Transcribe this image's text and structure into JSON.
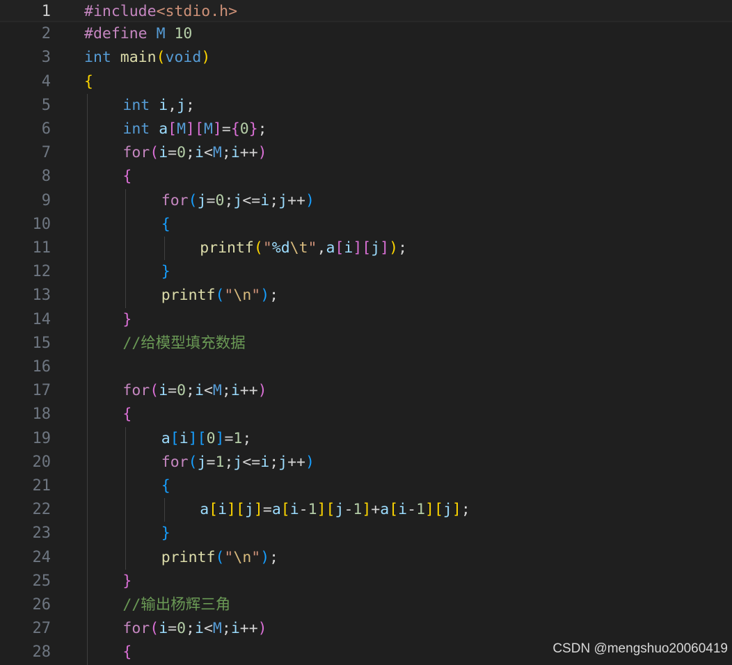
{
  "editor": {
    "active_line": 1,
    "colors": {
      "background": "#1f1f1f",
      "line_number": "#6e7681",
      "line_number_active": "#cccccc",
      "keyword": "#569cd6",
      "control": "#c586c0",
      "function": "#dcdcaa",
      "variable": "#9cdcfe",
      "number": "#b5cea8",
      "string": "#ce9178",
      "escape": "#d7ba7d",
      "comment": "#6a9955",
      "bracket_gold": "#ffd700",
      "bracket_pink": "#da70d6",
      "bracket_blue": "#179fff",
      "plain": "#d4d4d4"
    },
    "lines": [
      {
        "n": "1",
        "indent": 0,
        "tokens": [
          {
            "t": "#include",
            "c": "control"
          },
          {
            "t": "<stdio.h>",
            "c": "string"
          }
        ]
      },
      {
        "n": "2",
        "indent": 0,
        "tokens": [
          {
            "t": "#define",
            "c": "control"
          },
          {
            "t": " ",
            "c": "plain"
          },
          {
            "t": "M",
            "c": "keyword"
          },
          {
            "t": " ",
            "c": "plain"
          },
          {
            "t": "10",
            "c": "number"
          }
        ]
      },
      {
        "n": "3",
        "indent": 0,
        "tokens": [
          {
            "t": "int",
            "c": "keyword"
          },
          {
            "t": " ",
            "c": "plain"
          },
          {
            "t": "main",
            "c": "function"
          },
          {
            "t": "(",
            "c": "bracket_gold"
          },
          {
            "t": "void",
            "c": "keyword"
          },
          {
            "t": ")",
            "c": "bracket_gold"
          }
        ]
      },
      {
        "n": "4",
        "indent": 0,
        "tokens": [
          {
            "t": "{",
            "c": "bracket_gold"
          }
        ]
      },
      {
        "n": "5",
        "indent": 1,
        "tokens": [
          {
            "t": "int",
            "c": "keyword"
          },
          {
            "t": " ",
            "c": "plain"
          },
          {
            "t": "i",
            "c": "variable"
          },
          {
            "t": ",",
            "c": "plain"
          },
          {
            "t": "j",
            "c": "variable"
          },
          {
            "t": ";",
            "c": "plain"
          }
        ]
      },
      {
        "n": "6",
        "indent": 1,
        "tokens": [
          {
            "t": "int",
            "c": "keyword"
          },
          {
            "t": " ",
            "c": "plain"
          },
          {
            "t": "a",
            "c": "variable"
          },
          {
            "t": "[",
            "c": "bracket_pink"
          },
          {
            "t": "M",
            "c": "keyword"
          },
          {
            "t": "]",
            "c": "bracket_pink"
          },
          {
            "t": "[",
            "c": "bracket_pink"
          },
          {
            "t": "M",
            "c": "keyword"
          },
          {
            "t": "]",
            "c": "bracket_pink"
          },
          {
            "t": "=",
            "c": "plain"
          },
          {
            "t": "{",
            "c": "bracket_pink"
          },
          {
            "t": "0",
            "c": "number"
          },
          {
            "t": "}",
            "c": "bracket_pink"
          },
          {
            "t": ";",
            "c": "plain"
          }
        ]
      },
      {
        "n": "7",
        "indent": 1,
        "tokens": [
          {
            "t": "for",
            "c": "control"
          },
          {
            "t": "(",
            "c": "bracket_pink"
          },
          {
            "t": "i",
            "c": "variable"
          },
          {
            "t": "=",
            "c": "plain"
          },
          {
            "t": "0",
            "c": "number"
          },
          {
            "t": ";",
            "c": "plain"
          },
          {
            "t": "i",
            "c": "variable"
          },
          {
            "t": "<",
            "c": "plain"
          },
          {
            "t": "M",
            "c": "keyword"
          },
          {
            "t": ";",
            "c": "plain"
          },
          {
            "t": "i",
            "c": "variable"
          },
          {
            "t": "++",
            "c": "plain"
          },
          {
            "t": ")",
            "c": "bracket_pink"
          }
        ]
      },
      {
        "n": "8",
        "indent": 1,
        "tokens": [
          {
            "t": "{",
            "c": "bracket_pink"
          }
        ]
      },
      {
        "n": "9",
        "indent": 2,
        "tokens": [
          {
            "t": "for",
            "c": "control"
          },
          {
            "t": "(",
            "c": "bracket_blue"
          },
          {
            "t": "j",
            "c": "variable"
          },
          {
            "t": "=",
            "c": "plain"
          },
          {
            "t": "0",
            "c": "number"
          },
          {
            "t": ";",
            "c": "plain"
          },
          {
            "t": "j",
            "c": "variable"
          },
          {
            "t": "<=",
            "c": "plain"
          },
          {
            "t": "i",
            "c": "variable"
          },
          {
            "t": ";",
            "c": "plain"
          },
          {
            "t": "j",
            "c": "variable"
          },
          {
            "t": "++",
            "c": "plain"
          },
          {
            "t": ")",
            "c": "bracket_blue"
          }
        ]
      },
      {
        "n": "10",
        "indent": 2,
        "tokens": [
          {
            "t": "{",
            "c": "bracket_blue"
          }
        ]
      },
      {
        "n": "11",
        "indent": 3,
        "tokens": [
          {
            "t": "printf",
            "c": "function"
          },
          {
            "t": "(",
            "c": "bracket_gold"
          },
          {
            "t": "\"",
            "c": "string"
          },
          {
            "t": "%d",
            "c": "variable"
          },
          {
            "t": "\\t",
            "c": "escape"
          },
          {
            "t": "\"",
            "c": "string"
          },
          {
            "t": ",",
            "c": "plain"
          },
          {
            "t": "a",
            "c": "variable"
          },
          {
            "t": "[",
            "c": "bracket_pink"
          },
          {
            "t": "i",
            "c": "variable"
          },
          {
            "t": "]",
            "c": "bracket_pink"
          },
          {
            "t": "[",
            "c": "bracket_pink"
          },
          {
            "t": "j",
            "c": "variable"
          },
          {
            "t": "]",
            "c": "bracket_pink"
          },
          {
            "t": ")",
            "c": "bracket_gold"
          },
          {
            "t": ";",
            "c": "plain"
          }
        ]
      },
      {
        "n": "12",
        "indent": 2,
        "tokens": [
          {
            "t": "}",
            "c": "bracket_blue"
          }
        ]
      },
      {
        "n": "13",
        "indent": 2,
        "tokens": [
          {
            "t": "printf",
            "c": "function"
          },
          {
            "t": "(",
            "c": "bracket_blue"
          },
          {
            "t": "\"",
            "c": "string"
          },
          {
            "t": "\\n",
            "c": "escape"
          },
          {
            "t": "\"",
            "c": "string"
          },
          {
            "t": ")",
            "c": "bracket_blue"
          },
          {
            "t": ";",
            "c": "plain"
          }
        ]
      },
      {
        "n": "14",
        "indent": 1,
        "tokens": [
          {
            "t": "}",
            "c": "bracket_pink"
          }
        ]
      },
      {
        "n": "15",
        "indent": 1,
        "tokens": [
          {
            "t": "//给模型填充数据",
            "c": "comment"
          }
        ]
      },
      {
        "n": "16",
        "indent": 1,
        "tokens": []
      },
      {
        "n": "17",
        "indent": 1,
        "tokens": [
          {
            "t": "for",
            "c": "control"
          },
          {
            "t": "(",
            "c": "bracket_pink"
          },
          {
            "t": "i",
            "c": "variable"
          },
          {
            "t": "=",
            "c": "plain"
          },
          {
            "t": "0",
            "c": "number"
          },
          {
            "t": ";",
            "c": "plain"
          },
          {
            "t": "i",
            "c": "variable"
          },
          {
            "t": "<",
            "c": "plain"
          },
          {
            "t": "M",
            "c": "keyword"
          },
          {
            "t": ";",
            "c": "plain"
          },
          {
            "t": "i",
            "c": "variable"
          },
          {
            "t": "++",
            "c": "plain"
          },
          {
            "t": ")",
            "c": "bracket_pink"
          }
        ]
      },
      {
        "n": "18",
        "indent": 1,
        "tokens": [
          {
            "t": "{",
            "c": "bracket_pink"
          }
        ]
      },
      {
        "n": "19",
        "indent": 2,
        "tokens": [
          {
            "t": "a",
            "c": "variable"
          },
          {
            "t": "[",
            "c": "bracket_blue"
          },
          {
            "t": "i",
            "c": "variable"
          },
          {
            "t": "]",
            "c": "bracket_blue"
          },
          {
            "t": "[",
            "c": "bracket_blue"
          },
          {
            "t": "0",
            "c": "number"
          },
          {
            "t": "]",
            "c": "bracket_blue"
          },
          {
            "t": "=",
            "c": "plain"
          },
          {
            "t": "1",
            "c": "number"
          },
          {
            "t": ";",
            "c": "plain"
          }
        ]
      },
      {
        "n": "20",
        "indent": 2,
        "tokens": [
          {
            "t": "for",
            "c": "control"
          },
          {
            "t": "(",
            "c": "bracket_blue"
          },
          {
            "t": "j",
            "c": "variable"
          },
          {
            "t": "=",
            "c": "plain"
          },
          {
            "t": "1",
            "c": "number"
          },
          {
            "t": ";",
            "c": "plain"
          },
          {
            "t": "j",
            "c": "variable"
          },
          {
            "t": "<=",
            "c": "plain"
          },
          {
            "t": "i",
            "c": "variable"
          },
          {
            "t": ";",
            "c": "plain"
          },
          {
            "t": "j",
            "c": "variable"
          },
          {
            "t": "++",
            "c": "plain"
          },
          {
            "t": ")",
            "c": "bracket_blue"
          }
        ]
      },
      {
        "n": "21",
        "indent": 2,
        "tokens": [
          {
            "t": "{",
            "c": "bracket_blue"
          }
        ]
      },
      {
        "n": "22",
        "indent": 3,
        "tokens": [
          {
            "t": "a",
            "c": "variable"
          },
          {
            "t": "[",
            "c": "bracket_gold"
          },
          {
            "t": "i",
            "c": "variable"
          },
          {
            "t": "]",
            "c": "bracket_gold"
          },
          {
            "t": "[",
            "c": "bracket_gold"
          },
          {
            "t": "j",
            "c": "variable"
          },
          {
            "t": "]",
            "c": "bracket_gold"
          },
          {
            "t": "=",
            "c": "plain"
          },
          {
            "t": "a",
            "c": "variable"
          },
          {
            "t": "[",
            "c": "bracket_gold"
          },
          {
            "t": "i",
            "c": "variable"
          },
          {
            "t": "-",
            "c": "plain"
          },
          {
            "t": "1",
            "c": "number"
          },
          {
            "t": "]",
            "c": "bracket_gold"
          },
          {
            "t": "[",
            "c": "bracket_gold"
          },
          {
            "t": "j",
            "c": "variable"
          },
          {
            "t": "-",
            "c": "plain"
          },
          {
            "t": "1",
            "c": "number"
          },
          {
            "t": "]",
            "c": "bracket_gold"
          },
          {
            "t": "+",
            "c": "plain"
          },
          {
            "t": "a",
            "c": "variable"
          },
          {
            "t": "[",
            "c": "bracket_gold"
          },
          {
            "t": "i",
            "c": "variable"
          },
          {
            "t": "-",
            "c": "plain"
          },
          {
            "t": "1",
            "c": "number"
          },
          {
            "t": "]",
            "c": "bracket_gold"
          },
          {
            "t": "[",
            "c": "bracket_gold"
          },
          {
            "t": "j",
            "c": "variable"
          },
          {
            "t": "]",
            "c": "bracket_gold"
          },
          {
            "t": ";",
            "c": "plain"
          }
        ]
      },
      {
        "n": "23",
        "indent": 2,
        "tokens": [
          {
            "t": "}",
            "c": "bracket_blue"
          }
        ]
      },
      {
        "n": "24",
        "indent": 2,
        "tokens": [
          {
            "t": "printf",
            "c": "function"
          },
          {
            "t": "(",
            "c": "bracket_blue"
          },
          {
            "t": "\"",
            "c": "string"
          },
          {
            "t": "\\n",
            "c": "escape"
          },
          {
            "t": "\"",
            "c": "string"
          },
          {
            "t": ")",
            "c": "bracket_blue"
          },
          {
            "t": ";",
            "c": "plain"
          }
        ]
      },
      {
        "n": "25",
        "indent": 1,
        "tokens": [
          {
            "t": "}",
            "c": "bracket_pink"
          }
        ]
      },
      {
        "n": "26",
        "indent": 1,
        "tokens": [
          {
            "t": "//输出杨辉三角",
            "c": "comment"
          }
        ]
      },
      {
        "n": "27",
        "indent": 1,
        "tokens": [
          {
            "t": "for",
            "c": "control"
          },
          {
            "t": "(",
            "c": "bracket_pink"
          },
          {
            "t": "i",
            "c": "variable"
          },
          {
            "t": "=",
            "c": "plain"
          },
          {
            "t": "0",
            "c": "number"
          },
          {
            "t": ";",
            "c": "plain"
          },
          {
            "t": "i",
            "c": "variable"
          },
          {
            "t": "<",
            "c": "plain"
          },
          {
            "t": "M",
            "c": "keyword"
          },
          {
            "t": ";",
            "c": "plain"
          },
          {
            "t": "i",
            "c": "variable"
          },
          {
            "t": "++",
            "c": "plain"
          },
          {
            "t": ")",
            "c": "bracket_pink"
          }
        ]
      },
      {
        "n": "28",
        "indent": 1,
        "tokens": [
          {
            "t": "{",
            "c": "bracket_pink"
          }
        ]
      }
    ]
  },
  "watermark": "CSDN @mengshuo20060419"
}
